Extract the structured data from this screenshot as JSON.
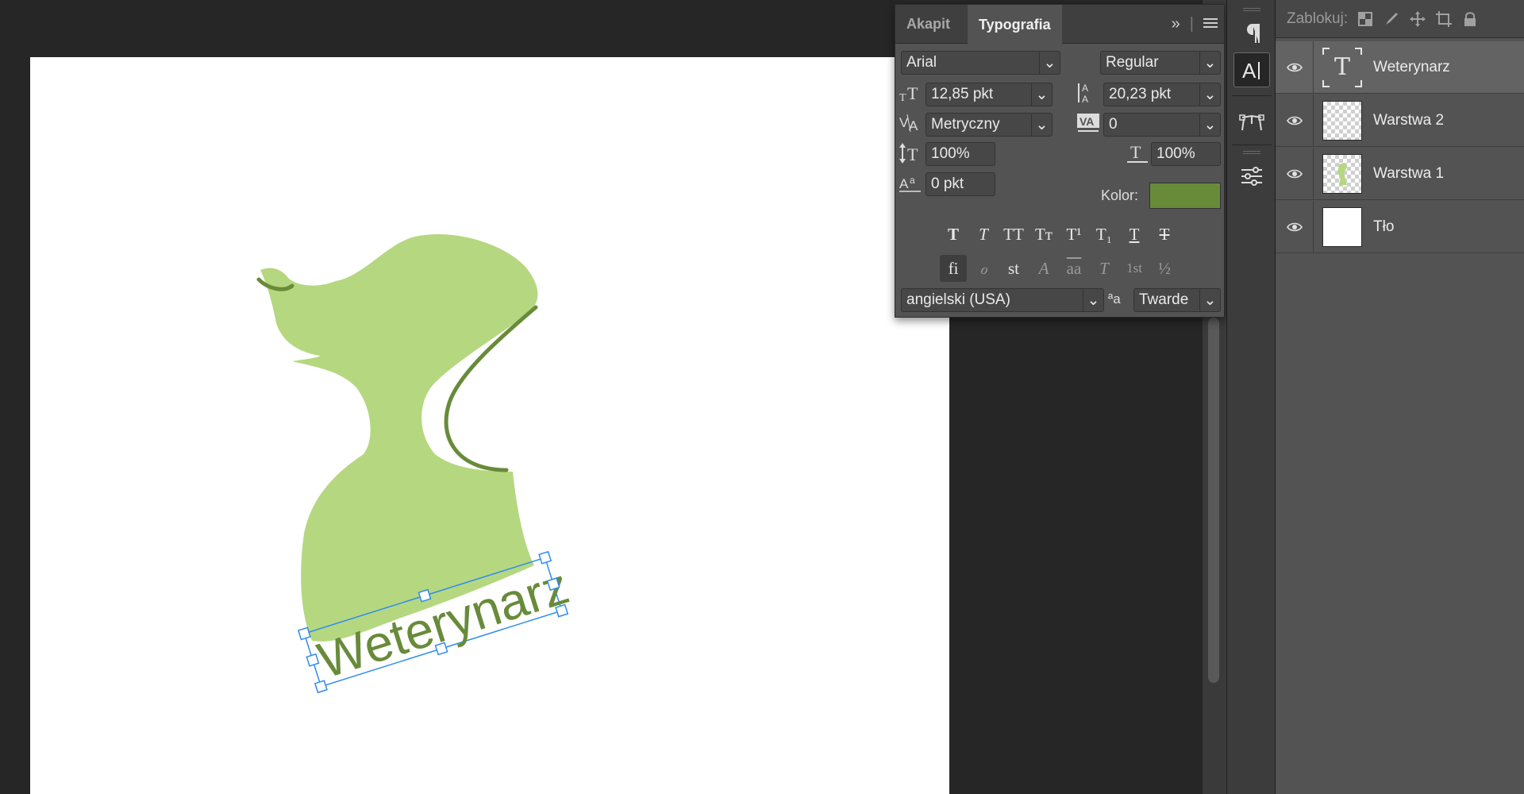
{
  "char_panel": {
    "tabs": [
      "Akapit",
      "Typografia"
    ],
    "active_tab": "Typografia",
    "font_family": "Arial",
    "font_style": "Regular",
    "font_size": "12,85 pkt",
    "leading": "20,23 pkt",
    "kerning": "Metryczny",
    "tracking": "0",
    "vertical_scale": "100%",
    "horizontal_scale": "100%",
    "baseline_shift": "0 pkt",
    "color_label": "Kolor:",
    "color_value": "#688b3a",
    "style_buttons_row1": [
      "T",
      "T",
      "TT",
      "Tт",
      "T¹",
      "T₁",
      "T",
      "T"
    ],
    "style_buttons_row2": [
      "fi",
      "ℴ",
      "st",
      "A",
      "aa",
      "T",
      "1st",
      "½"
    ],
    "language": "angielski (USA)",
    "antialias_icon": "ªa",
    "antialias": "Twarde"
  },
  "layers_panel": {
    "lock_label": "Zablokuj:",
    "layers": [
      {
        "name": "Weterynarz",
        "thumb": "text",
        "selected": true
      },
      {
        "name": "Warstwa 2",
        "thumb": "checker",
        "selected": false
      },
      {
        "name": "Warstwa 1",
        "thumb": "checker-art",
        "selected": false
      },
      {
        "name": "Tło",
        "thumb": "white",
        "selected": false
      }
    ]
  },
  "canvas": {
    "text_layer": "Weterynarz",
    "shape_color": "#b5d780",
    "line_color": "#688b3a",
    "selection_color": "#2f8cf0"
  }
}
